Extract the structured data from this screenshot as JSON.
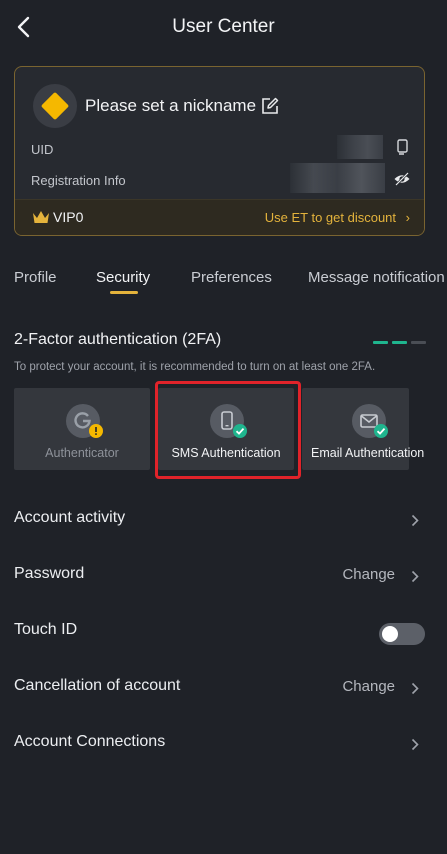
{
  "header": {
    "title": "User Center"
  },
  "user": {
    "nickname": "Please set a nickname",
    "uid_label": "UID",
    "registration_label": "Registration Info",
    "vip_level": "VIP0",
    "vip_link": "Use ET to get discount"
  },
  "tabs": [
    {
      "label": "Profile",
      "active": false
    },
    {
      "label": "Security",
      "active": true
    },
    {
      "label": "Preferences",
      "active": false
    },
    {
      "label": "Message notification",
      "active": false
    }
  ],
  "twofa": {
    "title": "2-Factor authentication (2FA)",
    "description": "To protect your account, it is recommended to turn on at least one 2FA.",
    "progress_enabled": 2,
    "progress_total": 3,
    "methods": [
      {
        "label": "Authenticator",
        "status": "warning"
      },
      {
        "label": "SMS Authentication",
        "status": "enabled"
      },
      {
        "label": "Email Authentication",
        "status": "enabled"
      }
    ]
  },
  "settings": {
    "account_activity": {
      "label": "Account activity"
    },
    "password": {
      "label": "Password",
      "value": "Change"
    },
    "touch_id": {
      "label": "Touch ID",
      "enabled": false
    },
    "cancellation": {
      "label": "Cancellation of account",
      "value": "Change"
    },
    "connections": {
      "label": "Account Connections"
    }
  },
  "colors": {
    "background": "#1f2228",
    "accent": "#e4b33c",
    "success": "#1fb58e",
    "warning": "#f5b800",
    "highlight": "#e0232a"
  }
}
